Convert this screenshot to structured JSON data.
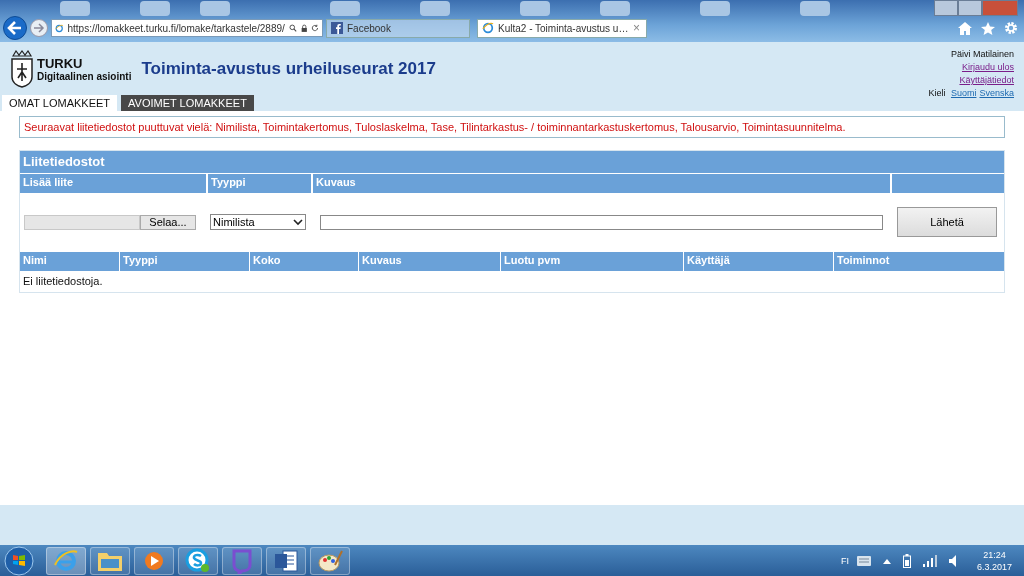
{
  "browser": {
    "address": "https://lomakkeet.turku.fi/lomake/tarkastele/2889/",
    "tabs": [
      {
        "title": "Facebook",
        "selected": false
      },
      {
        "title": "Kulta2 - Toiminta-avustus u…",
        "selected": true,
        "close": "×"
      }
    ]
  },
  "header": {
    "logo_name": "TURKU",
    "logo_subtitle": "Digitaalinen asiointi",
    "title": "Toiminta-avustus urheiluseurat 2017",
    "user_name": "Päivi Matilainen",
    "links": [
      "Kirjaudu ulos",
      "Käyttäjätiedot"
    ],
    "language_label": "Kieli",
    "languages": [
      "Suomi",
      "Svenska"
    ]
  },
  "nav_tabs": [
    {
      "label": "OMAT LOMAKKEET",
      "selected": true
    },
    {
      "label": "AVOIMET LOMAKKEET",
      "selected": false
    }
  ],
  "alert": "Seuraavat liitetiedostot puuttuvat vielä: Nimilista, Toimintakertomus, Tuloslaskelma, Tase, Tilintarkastus- / toiminnantarkastuskertomus, Talousarvio, Toimintasuunnitelma.",
  "attachments": {
    "title": "Liitetiedostot",
    "upload_columns": [
      "Lisää liite",
      "Tyyppi",
      "Kuvaus"
    ],
    "browse_button": "Selaa...",
    "type_value": "Nimilista",
    "send_button": "Lähetä",
    "file_columns": [
      "Nimi",
      "Tyyppi",
      "Koko",
      "Kuvaus",
      "Luotu pvm",
      "Käyttäjä",
      "Toiminnot"
    ],
    "empty_message": "Ei liitetiedostoja."
  },
  "taskbar": {
    "language": "FI",
    "time": "21:24",
    "date": "6.3.2017"
  }
}
